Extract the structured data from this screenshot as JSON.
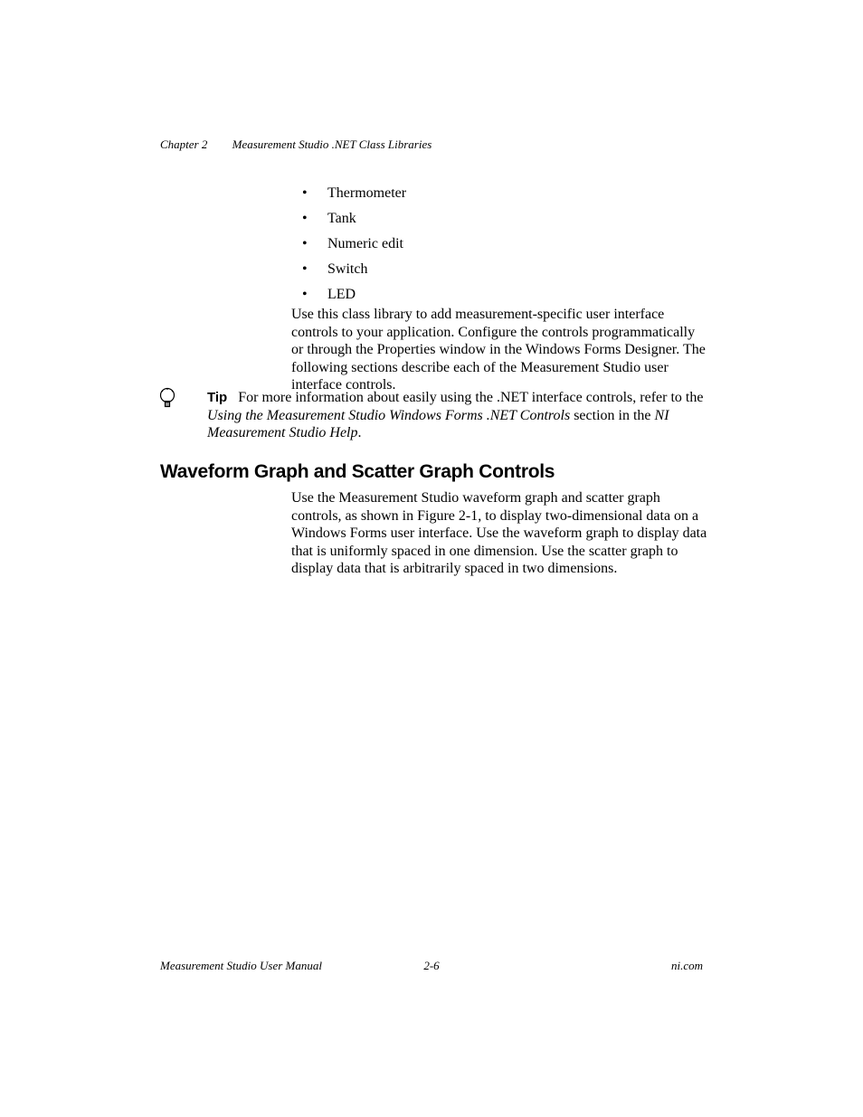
{
  "header": {
    "chapter": "Chapter 2",
    "title": "Measurement Studio .NET Class Libraries"
  },
  "bullets": [
    "Thermometer",
    "Tank",
    "Numeric edit",
    "Switch",
    "LED"
  ],
  "paragraph1": "Use this class library to add measurement-specific user interface controls to your application. Configure the controls programmatically or through the Properties window in the Windows Forms Designer. The following sections describe each of the Measurement Studio user interface controls.",
  "tip": {
    "label": "Tip",
    "text_before_italic1": "For more information about easily using the .NET interface controls, refer to the ",
    "italic1": "Using the Measurement Studio Windows Forms .NET Controls",
    "text_between": " section in the ",
    "italic2": "NI Measurement Studio Help",
    "text_after": "."
  },
  "section_heading": "Waveform Graph and Scatter Graph Controls",
  "paragraph2": "Use the Measurement Studio waveform graph and scatter graph controls, as shown in Figure 2-1, to display two-dimensional data on a Windows Forms user interface. Use the waveform graph to display data that is uniformly spaced in one dimension. Use the scatter graph to display data that is arbitrarily spaced in two dimensions.",
  "footer": {
    "left": "Measurement Studio User Manual",
    "center": "2-6",
    "right": "ni.com"
  }
}
